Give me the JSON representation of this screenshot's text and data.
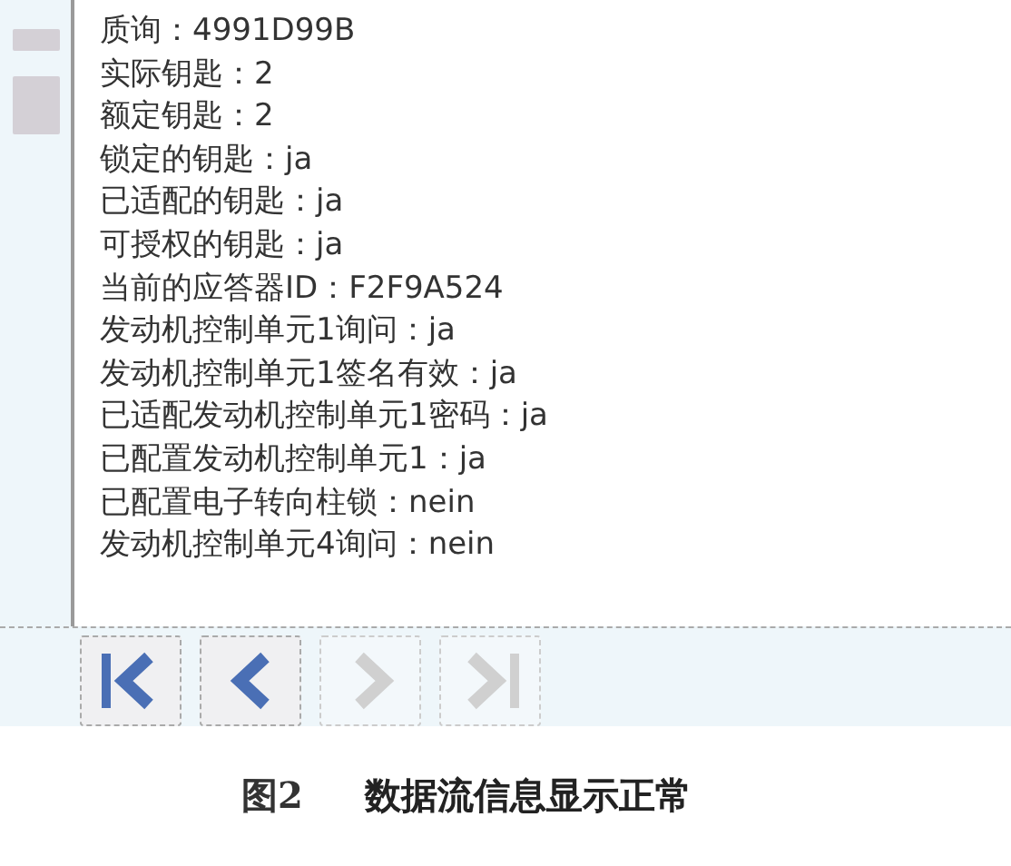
{
  "data_lines": [
    "质询：4991D99B",
    "实际钥匙：2",
    "额定钥匙：2",
    "锁定的钥匙：ja",
    "已适配的钥匙：ja",
    "可授权的钥匙：ja",
    "当前的应答器ID：F2F9A524",
    "发动机控制单元1询问：ja",
    "发动机控制单元1签名有效：ja",
    "已适配发动机控制单元1密码：ja",
    "已配置发动机控制单元1：ja",
    "已配置电子转向柱锁：nein",
    "发动机控制单元4询问：nein"
  ],
  "nav_buttons": [
    {
      "kind": "first",
      "disabled": false
    },
    {
      "kind": "prev",
      "disabled": false
    },
    {
      "kind": "next",
      "disabled": true
    },
    {
      "kind": "last",
      "disabled": true
    }
  ],
  "caption": {
    "number": "图2",
    "text": "数据流信息显示正常"
  }
}
